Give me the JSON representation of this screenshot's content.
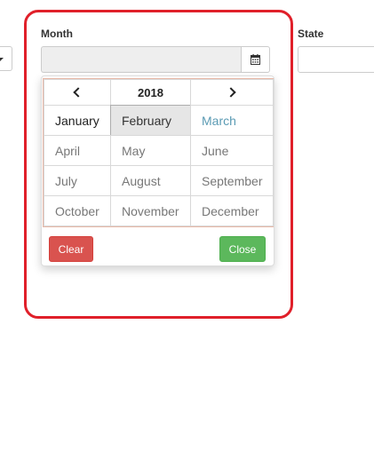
{
  "form": {
    "month_label": "Month",
    "state_label": "State",
    "month_value": "",
    "state_value": ""
  },
  "picker": {
    "year": "2018",
    "months": [
      {
        "label": "January",
        "state": "current"
      },
      {
        "label": "February",
        "state": "active"
      },
      {
        "label": "March",
        "state": "highlight"
      },
      {
        "label": "April",
        "state": "normal"
      },
      {
        "label": "May",
        "state": "normal"
      },
      {
        "label": "June",
        "state": "normal"
      },
      {
        "label": "July",
        "state": "normal"
      },
      {
        "label": "August",
        "state": "normal"
      },
      {
        "label": "September",
        "state": "normal"
      },
      {
        "label": "October",
        "state": "normal"
      },
      {
        "label": "November",
        "state": "normal"
      },
      {
        "label": "December",
        "state": "normal"
      }
    ],
    "clear_label": "Clear",
    "close_label": "Close"
  },
  "icons": {
    "calendar": "calendar-icon",
    "prev": "chevron-left-icon",
    "next": "chevron-right-icon",
    "dropdown": "caret-down-icon"
  },
  "colors": {
    "highlight_frame": "#e0202a",
    "clear_button": "#d9534f",
    "close_button": "#5cb85c",
    "highlight_month": "#5b9bb4"
  }
}
